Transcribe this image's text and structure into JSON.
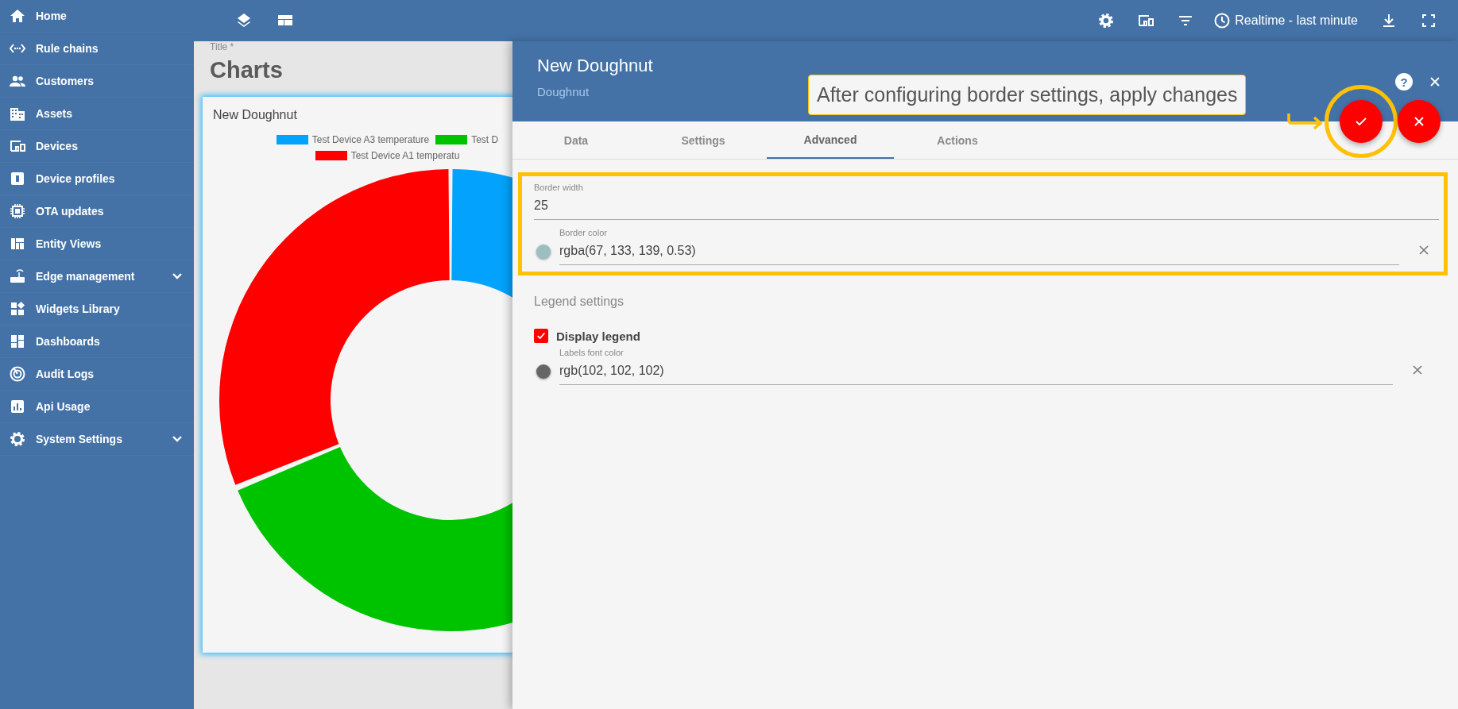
{
  "sidebar": {
    "items": [
      {
        "label": "Home",
        "expandable": false
      },
      {
        "label": "Rule chains",
        "expandable": false
      },
      {
        "label": "Customers",
        "expandable": false
      },
      {
        "label": "Assets",
        "expandable": false
      },
      {
        "label": "Devices",
        "expandable": false
      },
      {
        "label": "Device profiles",
        "expandable": false
      },
      {
        "label": "OTA updates",
        "expandable": false
      },
      {
        "label": "Entity Views",
        "expandable": false
      },
      {
        "label": "Edge management",
        "expandable": true
      },
      {
        "label": "Widgets Library",
        "expandable": false
      },
      {
        "label": "Dashboards",
        "expandable": false
      },
      {
        "label": "Audit Logs",
        "expandable": false
      },
      {
        "label": "Api Usage",
        "expandable": false
      },
      {
        "label": "System Settings",
        "expandable": true
      }
    ]
  },
  "toolbar": {
    "time_window": "Realtime - last minute"
  },
  "dashboard": {
    "title_label": "Title *",
    "title": "Charts",
    "widget": {
      "title": "New Doughnut",
      "legend": [
        {
          "label": "Test Device A3 temperature",
          "color": "#03a2fc"
        },
        {
          "label": "Test D",
          "color": "#00c300"
        },
        {
          "label": "Test Device A1 temperatu",
          "color": "#ff0000"
        }
      ]
    }
  },
  "dialog": {
    "title": "New Doughnut",
    "subtitle": "Doughnut",
    "help": "?",
    "tooltip": "After configuring border settings, apply changes",
    "tabs": [
      {
        "label": "Data",
        "selected": false
      },
      {
        "label": "Settings",
        "selected": false
      },
      {
        "label": "Advanced",
        "selected": true
      },
      {
        "label": "Actions",
        "selected": false
      }
    ],
    "border_fields": [
      {
        "kind": "text",
        "label": "Border width",
        "value": "25"
      },
      {
        "kind": "color",
        "label": "Border color",
        "value": "rgba(67, 133, 139, 0.53)",
        "color": "#9bbec1"
      }
    ],
    "legend_settings": {
      "title": "Legend settings",
      "display_legend": {
        "label": "Display legend",
        "checked": true
      },
      "fields": [
        {
          "kind": "color",
          "label": "Labels font color",
          "value": "rgb(102, 102, 102)",
          "color": "#666666"
        }
      ]
    }
  }
}
